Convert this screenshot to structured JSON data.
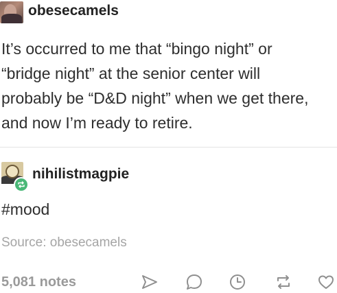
{
  "original_post": {
    "username": "obesecamels",
    "body_lines": [
      "It’s occurred to me that “bingo night” or",
      "“bridge night” at the senior center will",
      "probably be “D&D night” when we get there,",
      "and now I’m ready to retire."
    ]
  },
  "reblog": {
    "username": "nihilistmagpie",
    "text": "#mood",
    "source": "Source: obesecamels"
  },
  "footer": {
    "notes": "5,081 notes",
    "actions": [
      "share-icon",
      "reply-icon",
      "clock-icon",
      "reblog-icon",
      "heart-icon"
    ]
  },
  "colors": {
    "text": "#2e2e2e",
    "muted": "#a5a5a5",
    "reblog_badge": "#4ab877",
    "icon_stroke": "#8f8f8f"
  }
}
